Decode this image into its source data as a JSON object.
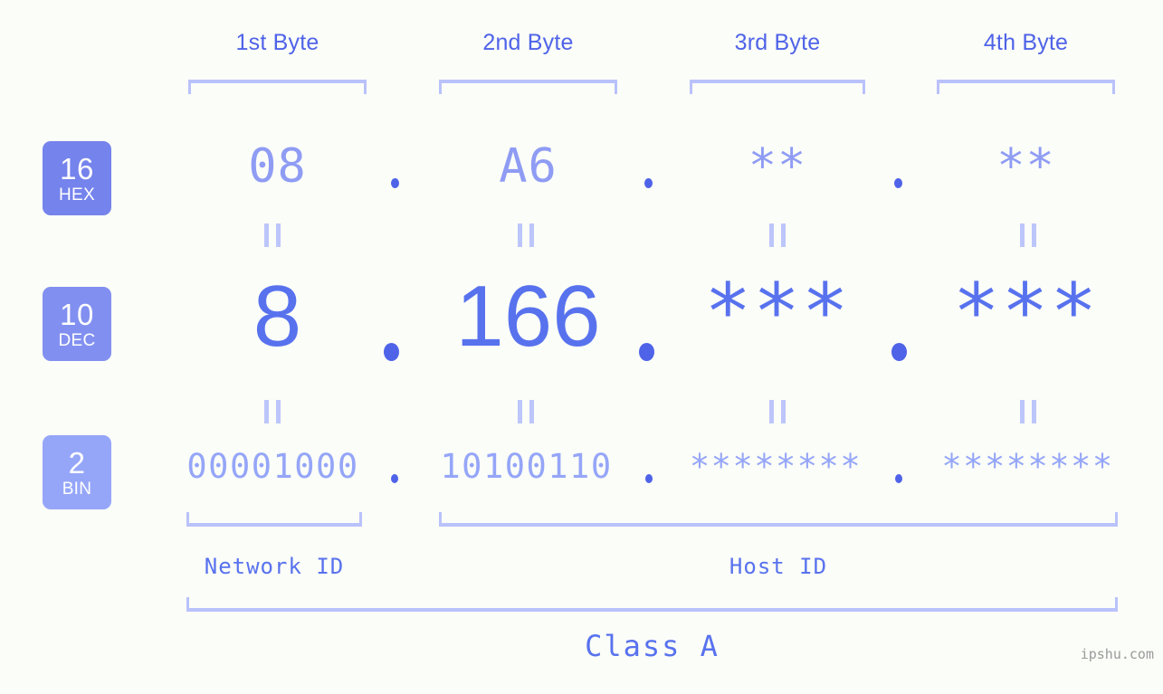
{
  "page": {
    "background_color": "#fbfdf8",
    "accent_color": "#5872ee",
    "light_accent_color": "#b9c2fb",
    "watermark": "ipshu.com"
  },
  "byte_headers": [
    {
      "label": "1st Byte"
    },
    {
      "label": "2nd Byte"
    },
    {
      "label": "3rd Byte"
    },
    {
      "label": "4th Byte"
    }
  ],
  "bases": [
    {
      "number": "16",
      "name": "HEX",
      "color": "#7583ec"
    },
    {
      "number": "10",
      "name": "DEC",
      "color": "#8190f0"
    },
    {
      "number": "2",
      "name": "BIN",
      "color": "#95a6f8"
    }
  ],
  "rows": {
    "hex": {
      "values": [
        "08",
        "A6",
        "**",
        "**"
      ],
      "separators": [
        ".",
        ".",
        "."
      ]
    },
    "dec": {
      "values": [
        "8",
        "166",
        "***",
        "***"
      ],
      "separators": [
        ".",
        ".",
        "."
      ]
    },
    "bin": {
      "values": [
        "00001000",
        "10100110",
        "********",
        "********"
      ],
      "separators": [
        ".",
        ".",
        "."
      ]
    }
  },
  "equality_markers": {
    "hex_to_dec": [
      "=",
      "=",
      "=",
      "="
    ],
    "dec_to_bin": [
      "=",
      "=",
      "=",
      "="
    ]
  },
  "id_sections": [
    {
      "label": "Network ID"
    },
    {
      "label": "Host ID"
    }
  ],
  "class": {
    "label": "Class A"
  }
}
